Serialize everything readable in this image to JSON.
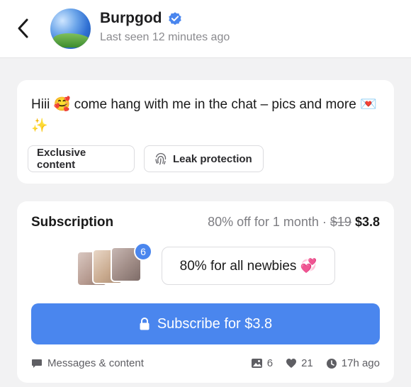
{
  "header": {
    "name": "Burpgod",
    "last_seen": "Last seen 12 minutes ago",
    "accent": "#4a86ee"
  },
  "bio": {
    "text": "Hiii 🥰 come hang with me in the chat – pics and more 💌✨",
    "chips": {
      "exclusive": "Exclusive content",
      "leak": "Leak protection"
    }
  },
  "subscription": {
    "title": "Subscription",
    "offer": "80% off for 1 month ·",
    "old_price": "$19",
    "new_price": "$3.8",
    "media_count": "6",
    "promo": "80% for all newbies 💞",
    "button": "Subscribe for $3.8",
    "footer": {
      "left": "Messages & content",
      "photos": "6",
      "likes": "21",
      "time": "17h ago"
    }
  },
  "icons": [
    "back-chevron-icon",
    "verified-icon",
    "fingerprint-icon",
    "lock-icon",
    "chat-bubble-icon",
    "image-icon",
    "heart-icon",
    "clock-icon"
  ]
}
